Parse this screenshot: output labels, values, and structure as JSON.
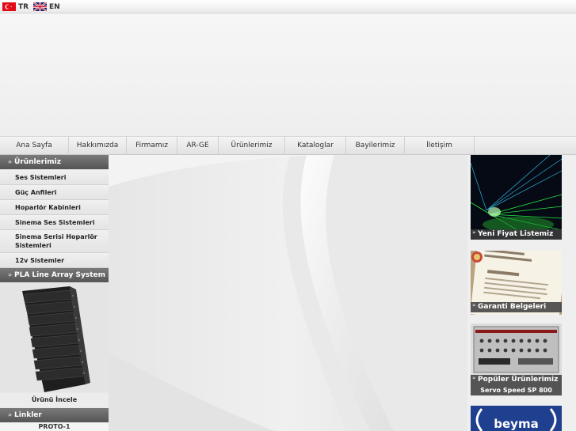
{
  "languages": [
    {
      "code": "TR",
      "icon": "turkish-flag-icon"
    },
    {
      "code": "EN",
      "icon": "uk-flag-icon"
    }
  ],
  "nav": {
    "items": [
      "Ana Sayfa",
      "Hakkımızda",
      "Firmamız",
      "AR-GE",
      "Ürünlerimiz",
      "Kataloglar",
      "Bayilerimiz",
      "İletişim"
    ]
  },
  "sidebar": {
    "products_title": "Ürünlerimiz",
    "items": [
      "Ses Sistemleri",
      "Güç Anfileri",
      "Hoparlör Kabinleri",
      "Sinema Ses Sistemleri",
      "Sinema Serisi Hoparlör Sistemleri",
      "12v Sistemler"
    ],
    "line_array_title": "PLA Line Array System",
    "product_link": "Ürünü İncele",
    "links_title": "Linkler",
    "proto": "PROTO-1"
  },
  "right": {
    "promo1": "Yeni Fiyat Listemiz",
    "promo2": "Garanti Belgeleri",
    "promo3": "Popüler Ürünlerimiz",
    "promo3_sub": "Servo Speed SP 800",
    "promo4_logo": "beyma"
  },
  "colors": {
    "accent_dark": "#555555",
    "background": "#f1f1f1"
  }
}
